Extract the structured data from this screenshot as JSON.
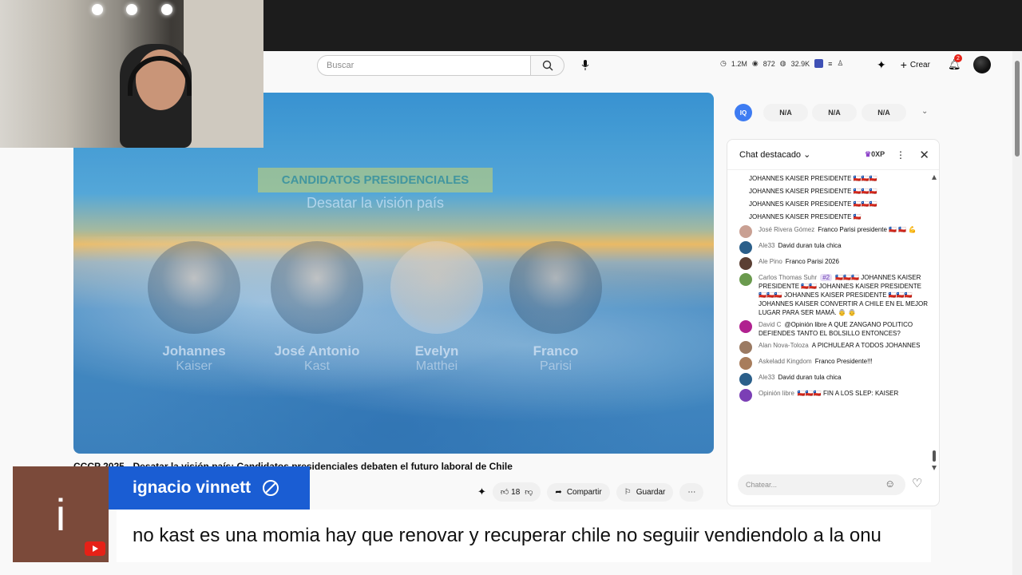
{
  "search": {
    "placeholder": "Buscar"
  },
  "stats": {
    "views": "1.2M",
    "watching": "872",
    "subs": "32.9K"
  },
  "header": {
    "create_label": "Crear",
    "notif_count": "2"
  },
  "video": {
    "overlay_title": "CANDIDATOS PRESIDENCIALES",
    "overlay_subtitle": "Desatar la visión país",
    "candidates": [
      {
        "first": "Johannes",
        "last": "Kaiser"
      },
      {
        "first": "José Antonio",
        "last": "Kast"
      },
      {
        "first": "Evelyn",
        "last": "Matthei"
      },
      {
        "first": "Franco",
        "last": "Parisi"
      }
    ],
    "title": "CCCP 2025 - Desatar la visión país: Candidatos presidenciales debaten el futuro laboral de Chile"
  },
  "actions": {
    "likes": "18",
    "share": "Compartir",
    "save": "Guardar"
  },
  "iq": {
    "label": "IQ",
    "values": [
      "N/A",
      "N/A",
      "N/A"
    ]
  },
  "chat": {
    "header": "Chat destacado",
    "xp": "0XP",
    "input_placeholder": "Chatear...",
    "continuation": [
      "JOHANNES KAISER PRESIDENTE 🇨🇱🇨🇱🇨🇱",
      "JOHANNES KAISER PRESIDENTE 🇨🇱🇨🇱🇨🇱",
      "JOHANNES KAISER PRESIDENTE 🇨🇱🇨🇱🇨🇱",
      "JOHANNES KAISER PRESIDENTE 🇨🇱"
    ],
    "messages": [
      {
        "author": "José Rivera Gómez",
        "text": "Franco Parisi presidente 🇨🇱 🇨🇱 💪",
        "color": "#c9a093"
      },
      {
        "author": "Ale33",
        "text": "David duran tula chica",
        "color": "#2b5f8a"
      },
      {
        "author": "Ale Pino",
        "text": "Franco Parisi 2026",
        "color": "#5b3f33"
      },
      {
        "author": "Carlos Thomas Suhr",
        "badge": "#2",
        "text": "🇨🇱🇨🇱🇨🇱 JOHANNES KAISER PRESIDENTE 🇨🇱🇨🇱 JOHANNES KAISER PRESIDENTE 🇨🇱🇨🇱🇨🇱 JOHANNES KAISER PRESIDENTE 🇨🇱🇨🇱🇨🇱 JOHANNES KAISER CONVERTIR A CHILE EN EL MEJOR LUGAR PARA SER MAMÁ. 👵 👵",
        "color": "#6a9a4e"
      },
      {
        "author": "David C",
        "text": "@Opinión libre A QUE ZANGANO POLITICO DEFIENDES TANTO EL BOLSILLO ENTONCES?",
        "color": "#b0218f"
      },
      {
        "author": "Alan Nova-Toloza",
        "text": "A PICHULEAR A TODOS JOHANNES",
        "color": "#9b7a62"
      },
      {
        "author": "Askeladd Kingdom",
        "text": "Franco Presidente!!!",
        "color": "#a87d5c"
      },
      {
        "author": "Ale33",
        "text": "David duran tula chica",
        "color": "#2b5f8a"
      },
      {
        "author": "Opinión libre",
        "text": "🇨🇱🇨🇱🇨🇱 FIN A LOS SLEP: KAISER",
        "color": "#7b3fb5"
      }
    ]
  },
  "comment": {
    "avatar_letter": "i",
    "name": "ignacio vinnett",
    "text": "no kast es una momia hay que renovar y recuperar chile no seguiir vendiendolo a la onu"
  }
}
